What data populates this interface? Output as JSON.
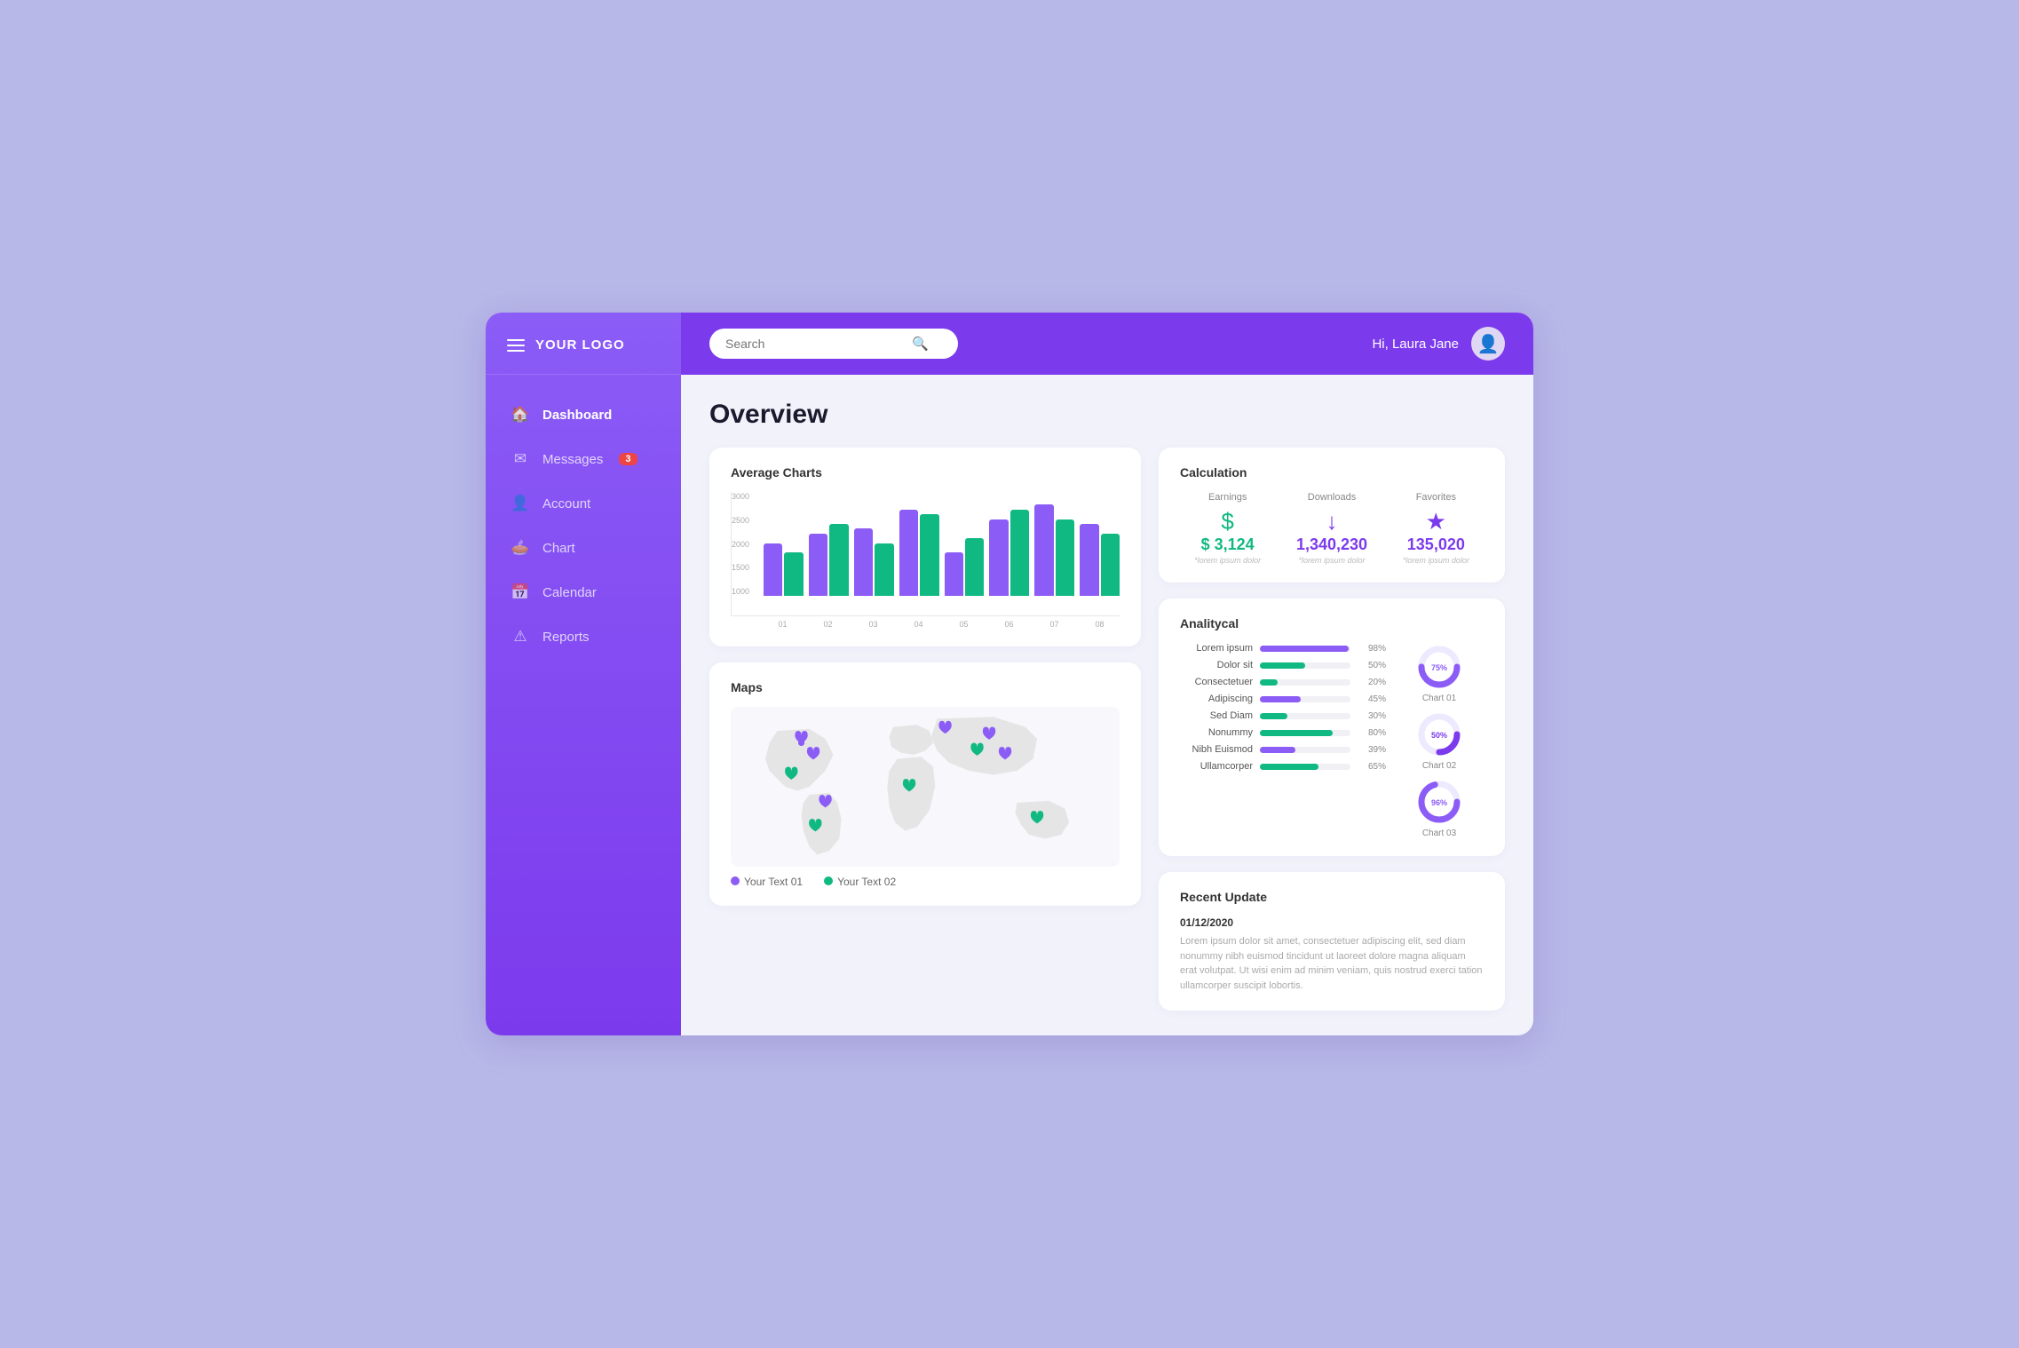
{
  "sidebar": {
    "logo": "YOUR LOGO",
    "nav_items": [
      {
        "id": "dashboard",
        "label": "Dashboard",
        "icon": "🏠",
        "active": true,
        "badge": null
      },
      {
        "id": "messages",
        "label": "Messages",
        "icon": "✉",
        "active": false,
        "badge": "3"
      },
      {
        "id": "account",
        "label": "Account",
        "icon": "👤",
        "active": false,
        "badge": null
      },
      {
        "id": "chart",
        "label": "Chart",
        "icon": "🥧",
        "active": false,
        "badge": null
      },
      {
        "id": "calendar",
        "label": "Calendar",
        "icon": "📅",
        "active": false,
        "badge": null
      },
      {
        "id": "reports",
        "label": "Reports",
        "icon": "⚠",
        "active": false,
        "badge": null
      }
    ]
  },
  "topbar": {
    "search_placeholder": "Search",
    "user_greeting": "Hi, Laura Jane"
  },
  "page": {
    "title": "Overview"
  },
  "average_charts": {
    "title": "Average Charts",
    "x_labels": [
      "01",
      "02",
      "03",
      "04",
      "05",
      "06",
      "07",
      "08"
    ],
    "y_labels": [
      "1000",
      "1500",
      "2000",
      "2500",
      "3000"
    ],
    "bars": [
      {
        "purple": 55,
        "green": 45
      },
      {
        "purple": 65,
        "green": 75
      },
      {
        "purple": 70,
        "green": 55
      },
      {
        "purple": 90,
        "green": 85
      },
      {
        "purple": 45,
        "green": 60
      },
      {
        "purple": 80,
        "green": 90
      },
      {
        "purple": 95,
        "green": 80
      },
      {
        "purple": 75,
        "green": 65
      }
    ]
  },
  "maps": {
    "title": "Maps",
    "legend": [
      {
        "label": "Your Text 01",
        "color": "#8b5cf6"
      },
      {
        "label": "Your Text 02",
        "color": "#10b981"
      }
    ]
  },
  "calculation": {
    "title": "Calculation",
    "items": [
      {
        "label": "Earnings",
        "icon": "$",
        "value": "$ 3,124",
        "sublabel": "*lorem ipsum dolor",
        "color": "green"
      },
      {
        "label": "Downloads",
        "icon": "↓",
        "value": "1,340,230",
        "sublabel": "*lorem ipsum dolor",
        "color": "purple"
      },
      {
        "label": "Favorites",
        "icon": "★",
        "value": "135,020",
        "sublabel": "*lorem ipsum dolor",
        "color": "purple"
      }
    ]
  },
  "analytical": {
    "title": "Analitycal",
    "rows": [
      {
        "label": "Lorem ipsum",
        "pct": 98,
        "color": "purple"
      },
      {
        "label": "Dolor sit",
        "pct": 50,
        "color": "green"
      },
      {
        "label": "Consectetuer",
        "pct": 20,
        "color": "green"
      },
      {
        "label": "Adipiscing",
        "pct": 45,
        "color": "purple"
      },
      {
        "label": "Sed Diam",
        "pct": 30,
        "color": "green"
      },
      {
        "label": "Nonummy",
        "pct": 80,
        "color": "green"
      },
      {
        "label": "Nibh Euismod",
        "pct": 39,
        "color": "purple"
      },
      {
        "label": "Ullamcorper",
        "pct": 65,
        "color": "green"
      }
    ],
    "donuts": [
      {
        "label": "Chart 01",
        "pct": 75,
        "color": "#8b5cf6"
      },
      {
        "label": "Chart 02",
        "pct": 50,
        "color": "#7c3aed"
      },
      {
        "label": "Chart 03",
        "pct": 96,
        "color": "#8b5cf6"
      }
    ]
  },
  "recent_update": {
    "title": "Recent Update",
    "date": "01/12/2020",
    "text": "Lorem ipsum dolor sit amet, consectetuer adipiscing elit, sed diam nonummy nibh euismod tincidunt ut laoreet dolore magna aliquam erat volutpat. Ut wisi enim ad minim veniam, quis nostrud exerci tation ullamcorper suscipit lobortis."
  }
}
